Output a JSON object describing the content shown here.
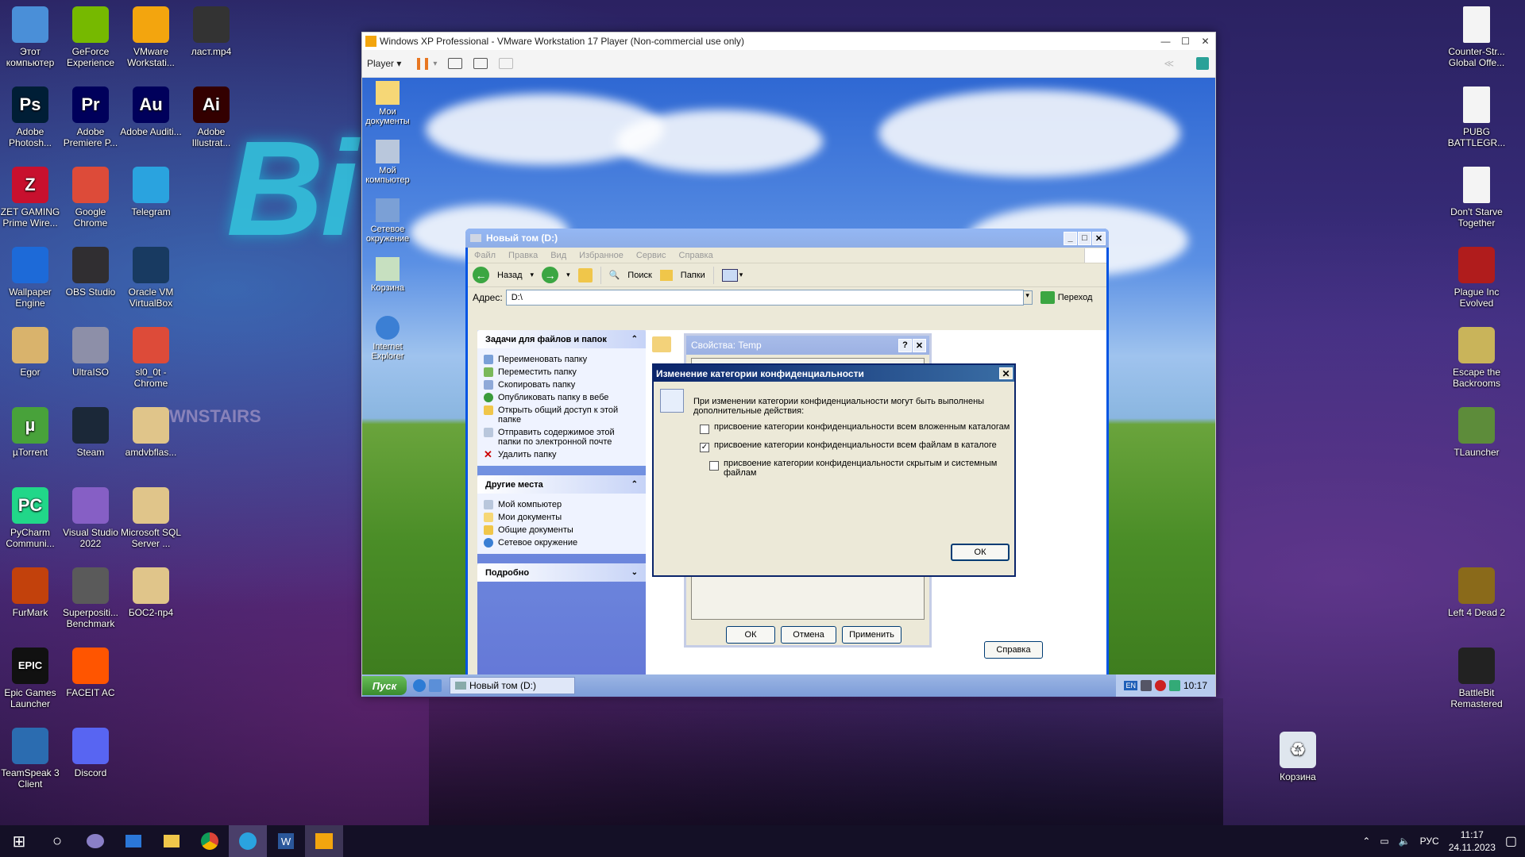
{
  "desktop": {
    "left_icons": [
      {
        "label": "Этот компьютер",
        "col": 0,
        "row": 0,
        "icon": "this-pc-icon",
        "color": "#4a8fd8"
      },
      {
        "label": "GeForce Experience",
        "col": 1,
        "row": 0,
        "icon": "geforce-icon",
        "color": "#76b900"
      },
      {
        "label": "VMware Workstati...",
        "col": 2,
        "row": 0,
        "icon": "vmware-icon",
        "color": "#f3a50e"
      },
      {
        "label": "ласт.mp4",
        "col": 3,
        "row": 0,
        "icon": "video-file-icon",
        "color": "#333"
      },
      {
        "label": "Adobe Photosh...",
        "col": 0,
        "row": 1,
        "icon": "photoshop-icon",
        "color": "#001e36",
        "text": "Ps"
      },
      {
        "label": "Adobe Premiere P...",
        "col": 1,
        "row": 1,
        "icon": "premiere-icon",
        "color": "#00005b",
        "text": "Pr"
      },
      {
        "label": "Adobe Auditi...",
        "col": 2,
        "row": 1,
        "icon": "audition-icon",
        "color": "#00005b",
        "text": "Au"
      },
      {
        "label": "Adobe Illustrat...",
        "col": 3,
        "row": 1,
        "icon": "illustrator-icon",
        "color": "#330000",
        "text": "Ai"
      },
      {
        "label": "ZET GAMING Prime Wire...",
        "col": 0,
        "row": 2,
        "icon": "zet-gaming-icon",
        "color": "#c8102e",
        "text": "Z"
      },
      {
        "label": "Google Chrome",
        "col": 1,
        "row": 2,
        "icon": "chrome-icon",
        "color": "#dd4b39"
      },
      {
        "label": "Telegram",
        "col": 2,
        "row": 2,
        "icon": "telegram-icon",
        "color": "#2aa3df"
      },
      {
        "label": "Wallpaper Engine",
        "col": 0,
        "row": 3,
        "icon": "wallpaper-engine-icon",
        "color": "#1d6ad8"
      },
      {
        "label": "OBS Studio",
        "col": 1,
        "row": 3,
        "icon": "obs-icon",
        "color": "#302e31"
      },
      {
        "label": "Oracle VM VirtualBox",
        "col": 2,
        "row": 3,
        "icon": "virtualbox-icon",
        "color": "#183a61"
      },
      {
        "label": "Egor",
        "col": 0,
        "row": 4,
        "icon": "folder-icon",
        "color": "#d9b36c"
      },
      {
        "label": "UltraISO",
        "col": 1,
        "row": 4,
        "icon": "ultraiso-icon",
        "color": "#8d8fa8"
      },
      {
        "label": "sl0_0t - Chrome",
        "col": 2,
        "row": 4,
        "icon": "chrome-icon",
        "color": "#dd4b39"
      },
      {
        "label": "µTorrent",
        "col": 0,
        "row": 5,
        "icon": "utorrent-icon",
        "color": "#48a23a",
        "text": "µ"
      },
      {
        "label": "Steam",
        "col": 1,
        "row": 5,
        "icon": "steam-icon",
        "color": "#1b2838"
      },
      {
        "label": "amdvbflas...",
        "col": 2,
        "row": 5,
        "icon": "archive-folder-icon",
        "color": "#e0c58a"
      },
      {
        "label": "PyCharm Communi...",
        "col": 0,
        "row": 6,
        "icon": "pycharm-icon",
        "color": "#21d789",
        "text": "PC"
      },
      {
        "label": "Visual Studio 2022",
        "col": 1,
        "row": 6,
        "icon": "visual-studio-icon",
        "color": "#865fc5"
      },
      {
        "label": "Microsoft SQL Server ...",
        "col": 2,
        "row": 6,
        "icon": "sql-server-icon",
        "color": "#e0c58a"
      },
      {
        "label": "FurMark",
        "col": 0,
        "row": 7,
        "icon": "furmark-icon",
        "color": "#c2410c"
      },
      {
        "label": "Superpositi... Benchmark",
        "col": 1,
        "row": 7,
        "icon": "superposition-icon",
        "color": "#5a5a5a"
      },
      {
        "label": "БОС2-пр4",
        "col": 2,
        "row": 7,
        "icon": "archive-folder-icon",
        "color": "#e0c58a"
      },
      {
        "label": "Epic Games Launcher",
        "col": 0,
        "row": 8,
        "icon": "epic-games-icon",
        "color": "#111",
        "text": "EPIC"
      },
      {
        "label": "FACEIT AC",
        "col": 1,
        "row": 8,
        "icon": "faceit-icon",
        "color": "#ff5500"
      },
      {
        "label": "TeamSpeak 3 Client",
        "col": 0,
        "row": 9,
        "icon": "teamspeak-icon",
        "color": "#2b6cb0"
      },
      {
        "label": "Discord",
        "col": 1,
        "row": 9,
        "icon": "discord-icon",
        "color": "#5865f2"
      }
    ],
    "right_icons": [
      {
        "label": "Counter-Str... Global Offe...",
        "row": 0,
        "icon": "document-icon",
        "color": "#f4f4f4"
      },
      {
        "label": "PUBG BATTLEGR...",
        "row": 1,
        "icon": "document-icon",
        "color": "#f4f4f4"
      },
      {
        "label": "Don't Starve Together",
        "row": 2,
        "icon": "document-icon",
        "color": "#f4f4f4"
      },
      {
        "label": "Plague Inc Evolved",
        "row": 3,
        "icon": "plague-inc-icon",
        "color": "#b01c1c"
      },
      {
        "label": "Escape the Backrooms",
        "row": 4,
        "icon": "backrooms-icon",
        "color": "#c9b45a"
      },
      {
        "label": "TLauncher",
        "row": 5,
        "icon": "tlauncher-icon",
        "color": "#5d8c3a"
      },
      {
        "label": "Left 4 Dead 2",
        "row": 7,
        "icon": "left4dead-icon",
        "color": "#8a6a1a"
      },
      {
        "label": "BattleBit Remastered",
        "row": 8,
        "icon": "battlebit-icon",
        "color": "#222"
      }
    ],
    "recycle_bin": "Корзина",
    "wallpaper_text": "Bi",
    "wallpaper_sign": "DOWNSTAIRS"
  },
  "vmware": {
    "title": "Windows XP Professional - VMware Workstation 17 Player (Non-commercial use only)",
    "player_menu": "Player ▾"
  },
  "guest": {
    "icons": [
      {
        "label": "Мои документы"
      },
      {
        "label": "Мой компьютер"
      },
      {
        "label": "Сетевое окружение"
      },
      {
        "label": "Корзина"
      },
      {
        "label": "Internet Explorer"
      }
    ],
    "explorer": {
      "title": "Новый том (D:)",
      "menu": [
        "Файл",
        "Правка",
        "Вид",
        "Избранное",
        "Сервис",
        "Справка"
      ],
      "back": "Назад",
      "search": "Поиск",
      "folders": "Папки",
      "address_label": "Адрес:",
      "address": "D:\\",
      "go": "Переход",
      "tasks_title": "Задачи для файлов и папок",
      "tasks": [
        "Переименовать папку",
        "Переместить папку",
        "Скопировать папку",
        "Опубликовать папку в вебе",
        "Открыть общий доступ к этой папке",
        "Отправить содержимое этой папки по электронной почте",
        "Удалить папку"
      ],
      "places_title": "Другие места",
      "places": [
        "Мой компьютер",
        "Мои документы",
        "Общие документы",
        "Сетевое окружение"
      ],
      "details_title": "Подробно"
    },
    "props": {
      "title": "Свойства: Temp",
      "ok": "ОК",
      "cancel": "Отмена",
      "apply": "Применить",
      "help": "Справка"
    },
    "dialog": {
      "title": "Изменение категории конфиденциальности",
      "text": "При изменении категории конфиденциальности могут быть выполнены дополнительные действия:",
      "cb1": "присвоение категории конфиденциальности всем вложенным каталогам",
      "cb1_checked": false,
      "cb2": "присвоение категории конфиденциальности всем файлам в каталоге",
      "cb2_checked": true,
      "cb3": "присвоение категории конфиденциальности скрытым и системным файлам",
      "cb3_checked": false,
      "ok": "ОК"
    },
    "taskbar": {
      "start": "Пуск",
      "task": "Новый том (D:)",
      "lang": "EN",
      "clock": "10:17"
    }
  },
  "taskbar": {
    "lang": "РУС",
    "time": "11:17",
    "date": "24.11.2023"
  }
}
